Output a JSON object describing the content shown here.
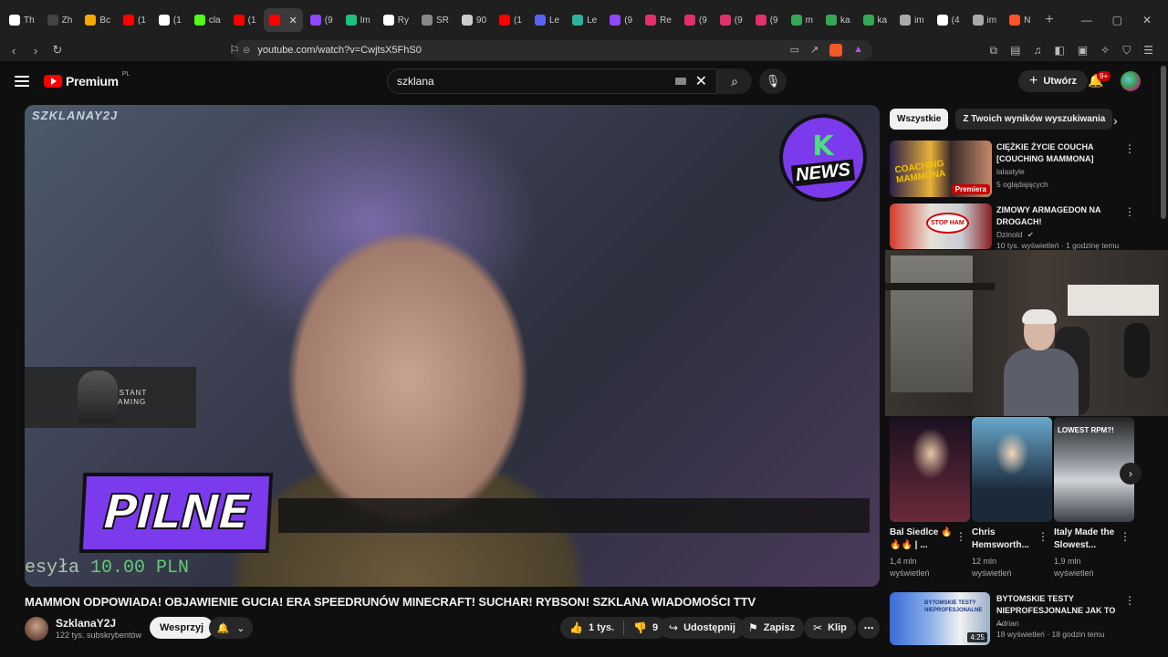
{
  "browser": {
    "tabs": [
      {
        "label": "Th",
        "color": "#ffffff"
      },
      {
        "label": "Zh",
        "color": "#444444"
      },
      {
        "label": "Bc",
        "color": "#f2a900"
      },
      {
        "label": "(1",
        "color": "#ff0000"
      },
      {
        "label": "(1",
        "color": "#ffffff"
      },
      {
        "label": "cla",
        "color": "#53fc18"
      },
      {
        "label": "(1",
        "color": "#ff0000"
      },
      {
        "label": "",
        "color": "#ff0000",
        "active": true
      },
      {
        "label": "(9",
        "color": "#9146ff"
      },
      {
        "label": "Im",
        "color": "#19c37d"
      },
      {
        "label": "Ry",
        "color": "#ffffff"
      },
      {
        "label": "SR",
        "color": "#888888"
      },
      {
        "label": "90",
        "color": "#cccccc"
      },
      {
        "label": "(1",
        "color": "#ff0000"
      },
      {
        "label": "Le",
        "color": "#5865f2"
      },
      {
        "label": "Le",
        "color": "#2bb3a0"
      },
      {
        "label": "(9",
        "color": "#9146ff"
      },
      {
        "label": "Re",
        "color": "#e1306c"
      },
      {
        "label": "(9",
        "color": "#e1306c"
      },
      {
        "label": "(9",
        "color": "#e1306c"
      },
      {
        "label": "(9",
        "color": "#e1306c"
      },
      {
        "label": "m",
        "color": "#34a853"
      },
      {
        "label": "ka",
        "color": "#34a853"
      },
      {
        "label": "ka",
        "color": "#34a853"
      },
      {
        "label": "im",
        "color": "#aaaaaa"
      },
      {
        "label": "(4",
        "color": "#ffffff"
      },
      {
        "label": "im",
        "color": "#aaaaaa"
      },
      {
        "label": "N",
        "color": "#fb542b"
      }
    ],
    "active_tab_close": "✕",
    "new_tab": "+",
    "url": "youtube.com/watch?v=CwjtsX5FhS0"
  },
  "youtube": {
    "logo_text": "Premium",
    "logo_region": "PL",
    "search_value": "szklana",
    "create_label": "Utwórz",
    "notifications_badge": "9+"
  },
  "video": {
    "watermark": "SZKLANAY2J",
    "news_badge_letter": "K",
    "news_badge_text": "NEWS",
    "ad_text_1": "INSTANT",
    "ad_text_2": "GAMING",
    "banner_text": "PILNE",
    "donation_prefix": "esyła",
    "donation_amount": "10.00 PLN",
    "title": "MAMMON ODPOWIADA! OBJAWIENIE GUCIA! ERA SPEEDRUNÓW MINECRAFT! SUCHAR! RYBSON! SZKLANA WIADOMOŚCI TTV",
    "channel_name": "SzklanaY2J",
    "channel_subs": "122 tys. subskrybentów",
    "support_label": "Wesprzyj",
    "likes": "1 tys.",
    "dislikes": "9",
    "share_label": "Udostępnij",
    "save_label": "Zapisz",
    "clip_label": "Klip"
  },
  "sidebar": {
    "chips": [
      {
        "label": "Wszystkie",
        "active": true
      },
      {
        "label": "Z Twoich wyników wyszukiwania",
        "active": false
      }
    ],
    "recs": [
      {
        "title": "CIĘŻKIE ŻYCIE COUCHA [COUCHING MAMMONA]",
        "channel": "lalastyle",
        "meta": "5 oglądających",
        "badge": "Premiera",
        "thumb_text": "COACHING MAMMONA"
      },
      {
        "title": "ZIMOWY ARMAGEDON NA DROGACH!",
        "channel": "Dzinold",
        "meta": "10 tys. wyświetleń · 1 godzinę temu",
        "thumb_text": "STOP HAM"
      },
      {
        "title": "BYTOMSKIE TESTY NIEPROFESJONALNE JAK TO ...",
        "channel": "Adrian",
        "meta": "18 wyświetleń · 18 godzin temu",
        "duration": "4:25",
        "thumb_text": "BYTOMSKIE TESTY NIEPROFESJONALNE"
      }
    ],
    "shorts": [
      {
        "title": "Bal Siedlce 🔥🔥🔥 | ...",
        "views": "1,4 mln",
        "views_suffix": "wyświetleń",
        "color": "#3a2230"
      },
      {
        "title": "Chris Hemsworth...",
        "views": "12 mln",
        "views_suffix": "wyświetleń",
        "color": "#3f6f8f"
      },
      {
        "title": "Italy Made the Slowest...",
        "views": "1,9 mln",
        "views_suffix": "wyświetleń",
        "color": "#5a5f66",
        "overlay": "LOWEST RPM?!"
      }
    ]
  },
  "colors": {
    "yt_red": "#ff0000",
    "banner_purple": "#7c3aed",
    "news_green": "#4ade80"
  }
}
